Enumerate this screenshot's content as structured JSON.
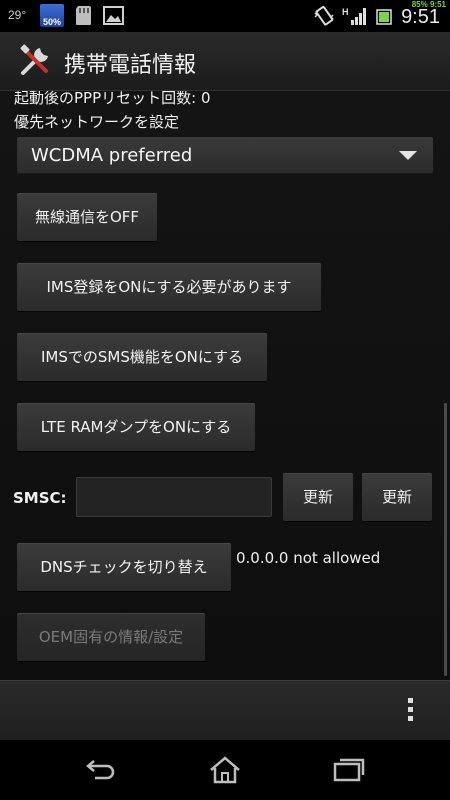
{
  "status_bar": {
    "temperature": "29°",
    "battery_app_label": "50%",
    "battery_percent": "85%",
    "battery_time_small": "9:51",
    "time": "9:51",
    "network_type": "H"
  },
  "action_bar": {
    "title": "携帯電話情報"
  },
  "content": {
    "ppp_reset_line": "起動後のPPPリセット回数: 0",
    "preferred_network_label": "優先ネットワークを設定",
    "network_spinner_value": "WCDMA preferred",
    "buttons": {
      "radio_off": "無線通信をOFF",
      "ims_register": "IMS登録をONにする必要があります",
      "ims_sms": "IMSでのSMS機能をONにする",
      "lte_ram_dump": "LTE RAMダンプをONにする",
      "smsc_update_1": "更新",
      "smsc_update_2": "更新",
      "dns_check": "DNSチェックを切り替え",
      "oem_info": "OEM固有の情報/設定"
    },
    "smsc_label": "SMSC:",
    "smsc_value": "",
    "dns_status": "0.0.0.0 not allowed"
  },
  "colors": {
    "background": "#0b0b0b",
    "button": "#333333",
    "text": "#f0f0f0",
    "battery_green": "#7fd34a"
  },
  "icons": {
    "app": "tools-icon",
    "menu": "overflow-menu-icon",
    "nav": [
      "back-icon",
      "home-icon",
      "recent-apps-icon"
    ]
  }
}
